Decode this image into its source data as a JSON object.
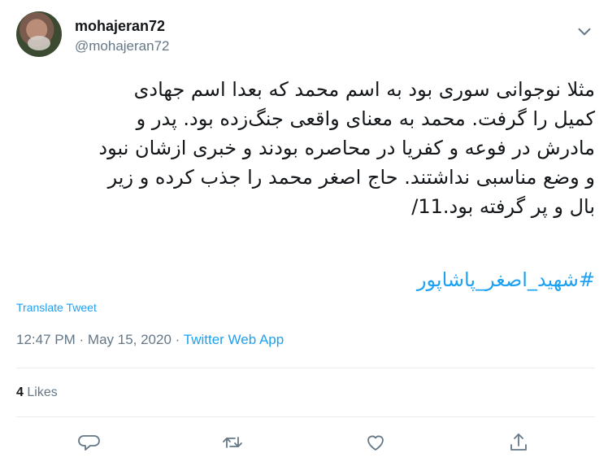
{
  "user": {
    "display_name": "mohajeran72",
    "handle": "@mohajeran72"
  },
  "tweet": {
    "text": "مثلا نوجوانی سوری بود به اسم محمد که بعدا اسم جهادی\nکمیل را گرفت. محمد به معنای واقعی جنگ‌زده بود. پدر و\nمادرش در فوعه و کفریا در محاصره بودند و خبری ازشان نبود\nو وضع مناسبی نداشتند. حاج اصغر محمد را جذب کرده و زیر\nبال و پر گرفته بود.11/",
    "hashtag": "#شهید_اصغر_پاشاپور",
    "translate_label": "Translate Tweet"
  },
  "meta": {
    "time": "12:47 PM",
    "separator": "·",
    "date": "May 15, 2020",
    "app": "Twitter Web App"
  },
  "stats": {
    "likes_count": "4",
    "likes_label": "Likes"
  },
  "icons": {
    "menu": "chevron-down-icon",
    "reply": "reply-icon",
    "retweet": "retweet-icon",
    "like": "heart-icon",
    "share": "share-icon"
  },
  "colors": {
    "accent": "#1da1f2",
    "text": "#14171a",
    "secondary": "#657786",
    "divider": "#e6ecf0"
  }
}
